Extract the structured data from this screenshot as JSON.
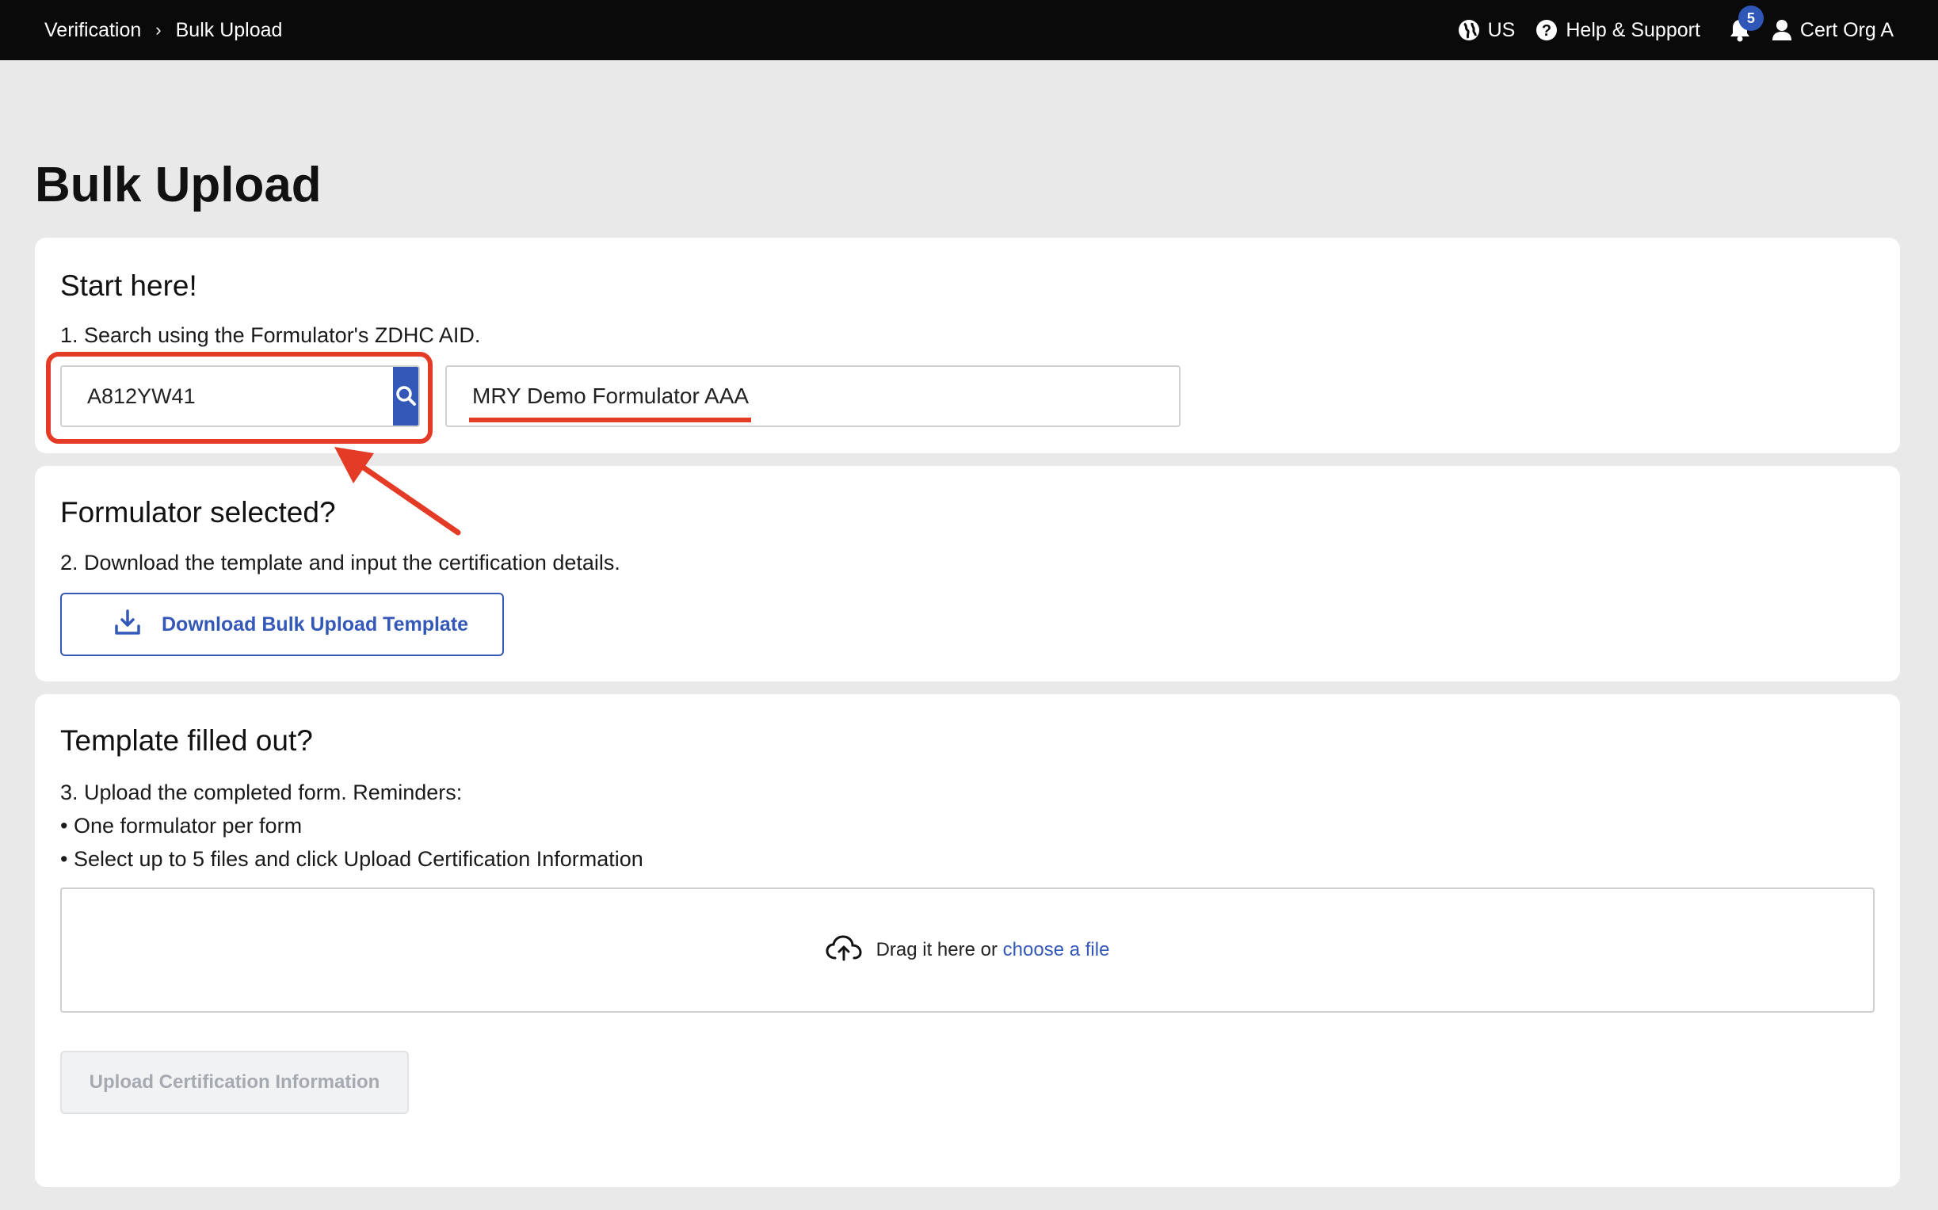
{
  "topbar": {
    "breadcrumb": [
      "Verification",
      "Bulk Upload"
    ],
    "region": "US",
    "help": "Help & Support",
    "notifications_count": "5",
    "user": "Cert Org A"
  },
  "page": {
    "title": "Bulk Upload"
  },
  "step1": {
    "heading": "Start here!",
    "instruction": "1. Search using the Formulator's ZDHC AID.",
    "search_value": "A812YW41",
    "formulator_name": "MRY Demo Formulator AAA"
  },
  "step2": {
    "heading": "Formulator selected?",
    "instruction": "2. Download the template and input the certification details.",
    "download_label": "Download Bulk Upload Template"
  },
  "step3": {
    "heading": "Template filled out?",
    "lines": [
      "3. Upload the completed form. Reminders:",
      "• One formulator per form",
      "• Select up to 5 files and click Upload Certification Information"
    ],
    "drop_text": "Drag it here or",
    "drop_link": "choose a file",
    "upload_label": "Upload Certification Information"
  },
  "colors": {
    "accent": "#3358b8",
    "annotation": "#e33b26",
    "topbar": "#0a0a0a"
  }
}
